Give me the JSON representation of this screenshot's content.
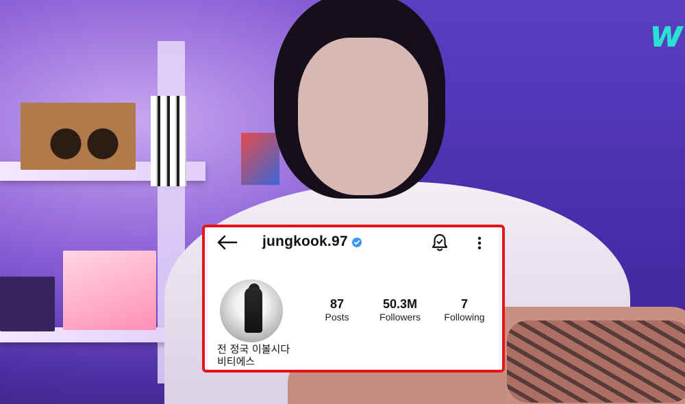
{
  "brand": {
    "logo_text": "w",
    "logo_color": "#29e0d4"
  },
  "profile": {
    "username": "jungkook.97",
    "verified": true,
    "stats": [
      {
        "value": "87",
        "label": "Posts"
      },
      {
        "value": "50.3M",
        "label": "Followers"
      },
      {
        "value": "7",
        "label": "Following"
      }
    ],
    "bio_lines": [
      "전 정국 이볼시다",
      "비티에스"
    ],
    "icons": {
      "back": "arrow-left-icon",
      "verified": "verified-badge-icon",
      "notifications": "bell-icon",
      "more": "more-vertical-icon"
    }
  },
  "colors": {
    "highlight_border": "#e8131a",
    "verified_blue": "#3897f0",
    "card_background": "#ffffff"
  }
}
